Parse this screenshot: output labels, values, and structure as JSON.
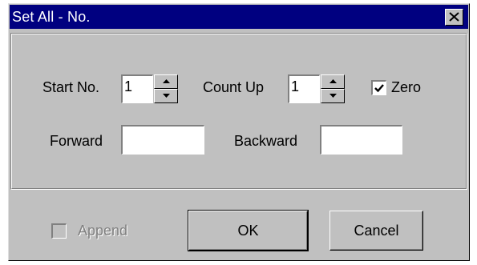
{
  "window": {
    "title": "Set All - No.",
    "close_label": "close"
  },
  "form": {
    "start_no": {
      "label": "Start No.",
      "value": "1"
    },
    "count_up": {
      "label": "Count Up",
      "value": "1"
    },
    "zero": {
      "label": "Zero",
      "checked": true
    },
    "forward": {
      "label": "Forward",
      "value": ""
    },
    "backward": {
      "label": "Backward",
      "value": ""
    }
  },
  "footer": {
    "append": {
      "label": "Append",
      "checked": false,
      "enabled": false
    },
    "ok_label": "OK",
    "cancel_label": "Cancel"
  },
  "colors": {
    "titlebar": "#000080",
    "face": "#c0c0c0",
    "disabled_text": "#808080"
  },
  "icons": {
    "close": "close-icon",
    "spin_up": "arrow-up-icon",
    "spin_down": "arrow-down-icon",
    "check": "checkmark-icon"
  }
}
